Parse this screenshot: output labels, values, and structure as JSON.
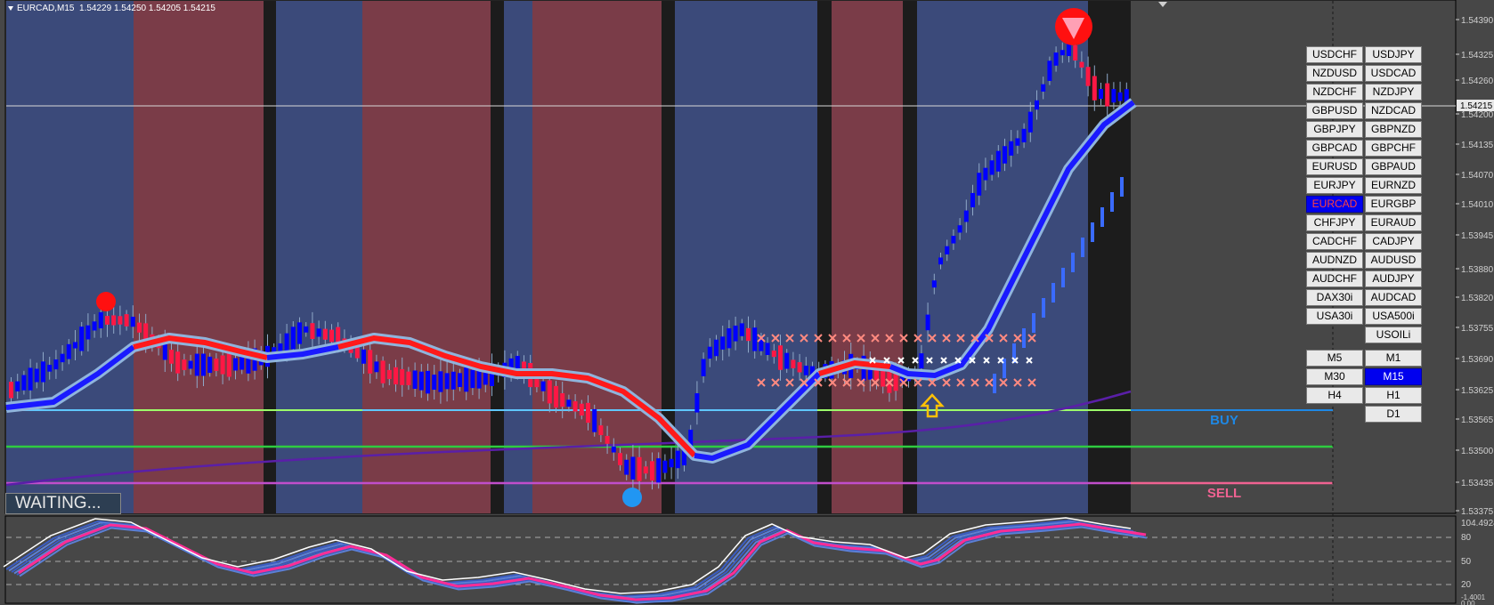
{
  "chart": {
    "symbol": "EURCAD,M15",
    "ohlc": "1.54229 1.54250 1.54205 1.54215",
    "status": "WAITING...",
    "buy_label": "BUY",
    "sell_label": "SELL",
    "price_axis": [
      "1.54390",
      "1.54325",
      "1.54260",
      "1.54200",
      "1.54135",
      "1.54070",
      "1.54010",
      "1.53945",
      "1.53880",
      "1.53820",
      "1.53755",
      "1.53690",
      "1.53625",
      "1.53565",
      "1.53500",
      "1.53435",
      "1.53375"
    ],
    "current_price": "1.54215",
    "osc_axis": [
      "104.4924",
      "80",
      "50",
      "20",
      "-1.4001",
      "0.00"
    ]
  },
  "symbols": [
    [
      "USDCHF",
      "USDJPY"
    ],
    [
      "NZDUSD",
      "USDCAD"
    ],
    [
      "NZDCHF",
      "NZDJPY"
    ],
    [
      "GBPUSD",
      "NZDCAD"
    ],
    [
      "GBPJPY",
      "GBPNZD"
    ],
    [
      "GBPCAD",
      "GBPCHF"
    ],
    [
      "EURUSD",
      "GBPAUD"
    ],
    [
      "EURJPY",
      "EURNZD"
    ],
    [
      "EURCAD",
      "EURGBP"
    ],
    [
      "CHFJPY",
      "EURAUD"
    ],
    [
      "CADCHF",
      "CADJPY"
    ],
    [
      "AUDNZD",
      "AUDUSD"
    ],
    [
      "AUDCHF",
      "AUDJPY"
    ],
    [
      "DAX30i",
      "AUDCAD"
    ],
    [
      "USA30i",
      "USA500i"
    ],
    [
      "",
      "USOILi"
    ]
  ],
  "active_symbol": "EURCAD",
  "timeframes": [
    [
      "M5",
      "M1"
    ],
    [
      "M30",
      "M15"
    ],
    [
      "H4",
      "H1"
    ],
    [
      "",
      "D1"
    ]
  ],
  "active_timeframe": "M15",
  "colors": {
    "background": "#474747",
    "blue_zone": "#3b4a7a",
    "red_zone": "#7a3c48",
    "dark_zone": "#1c1c1c",
    "bull_candle": "#0000ff",
    "bear_candle": "#ff1744",
    "buy_line": "#1e88e5",
    "sell_line": "#f06292",
    "green_line": "#2ecc40"
  }
}
